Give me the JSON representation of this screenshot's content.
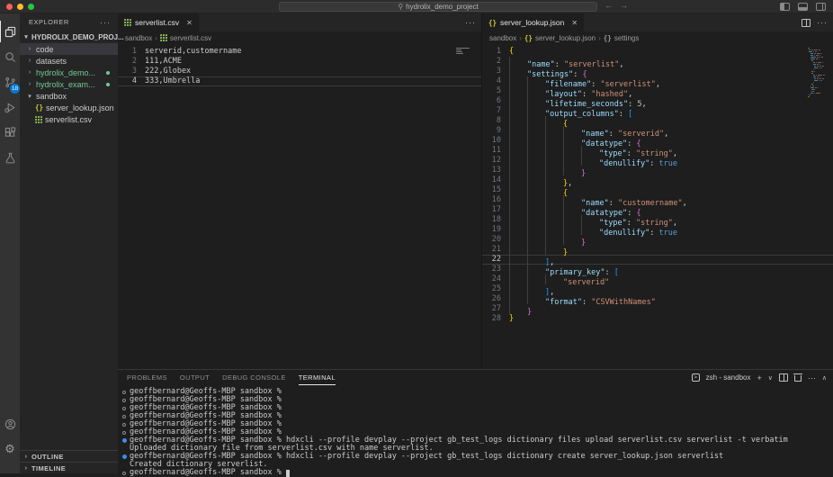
{
  "titlebar": {
    "search_text": "hydrolix_demo_project",
    "back_arrow": "←",
    "forward_arrow": "→",
    "traffic_colors": {
      "close": "#ff5f57",
      "minimize": "#febc2e",
      "zoom": "#28c840"
    }
  },
  "activity_bar": {
    "items": [
      "explorer",
      "search",
      "source-control",
      "run-and-debug",
      "extensions",
      "testing"
    ],
    "active_item": "explorer",
    "source_control_badge": "18",
    "bottom_items": [
      "accounts",
      "settings"
    ]
  },
  "sidebar": {
    "title": "EXPLORER",
    "more_actions": "···",
    "root_label": "HYDROLIX_DEMO_PROJ...",
    "items": [
      {
        "label": "code",
        "kind": "folder",
        "chevron": "right",
        "selected": true
      },
      {
        "label": "datasets",
        "kind": "folder",
        "chevron": "right"
      },
      {
        "label": "hydrolix_demo...",
        "kind": "folder",
        "chevron": "right",
        "green": true,
        "dot": true
      },
      {
        "label": "hydrolix_exam...",
        "kind": "folder",
        "chevron": "right",
        "green": true,
        "dot": true
      },
      {
        "label": "sandbox",
        "kind": "folder",
        "chevron": "down"
      },
      {
        "label": "server_lookup.json",
        "kind": "file",
        "icon": "json"
      },
      {
        "label": "serverlist.csv",
        "kind": "file",
        "icon": "csv"
      }
    ],
    "bottom_sections": [
      "OUTLINE",
      "TIMELINE"
    ]
  },
  "editor_left": {
    "tab_label": "serverlist.csv",
    "tab_icon": "csv",
    "close_glyph": "✕",
    "more_actions": "···",
    "breadcrumb": [
      {
        "label": "sandbox"
      },
      {
        "label": "serverlist.csv",
        "icon": "csv"
      }
    ],
    "active_line": 4,
    "lines": [
      "serverid,customername",
      "111,ACME",
      "222,Globex",
      "333,Umbrella"
    ]
  },
  "editor_right": {
    "tab_label": "server_lookup.json",
    "tab_icon": "json",
    "close_glyph": "✕",
    "more_actions": "···",
    "breadcrumb": [
      {
        "label": "sandbox"
      },
      {
        "label": "server_lookup.json",
        "icon": "json"
      },
      {
        "label": "settings",
        "icon": "json-gray"
      }
    ],
    "active_line": 22,
    "lines": [
      [
        [
          "g",
          "{"
        ]
      ],
      [
        [
          "p",
          "    "
        ],
        [
          "k",
          "\"name\""
        ],
        [
          "p",
          ": "
        ],
        [
          "s",
          "\"serverlist\""
        ],
        [
          "p",
          ","
        ]
      ],
      [
        [
          "p",
          "    "
        ],
        [
          "k",
          "\"settings\""
        ],
        [
          "p",
          ": "
        ],
        [
          "m",
          "{"
        ]
      ],
      [
        [
          "p",
          "        "
        ],
        [
          "k",
          "\"filename\""
        ],
        [
          "p",
          ": "
        ],
        [
          "s",
          "\"serverlist\""
        ],
        [
          "p",
          ","
        ]
      ],
      [
        [
          "p",
          "        "
        ],
        [
          "k",
          "\"layout\""
        ],
        [
          "p",
          ": "
        ],
        [
          "s",
          "\"hashed\""
        ],
        [
          "p",
          ","
        ]
      ],
      [
        [
          "p",
          "        "
        ],
        [
          "k",
          "\"lifetime_seconds\""
        ],
        [
          "p",
          ": "
        ],
        [
          "n",
          "5"
        ],
        [
          "p",
          ","
        ]
      ],
      [
        [
          "p",
          "        "
        ],
        [
          "k",
          "\"output_columns\""
        ],
        [
          "p",
          ": "
        ],
        [
          "u",
          "["
        ]
      ],
      [
        [
          "p",
          "            "
        ],
        [
          "g",
          "{"
        ]
      ],
      [
        [
          "p",
          "                "
        ],
        [
          "k",
          "\"name\""
        ],
        [
          "p",
          ": "
        ],
        [
          "s",
          "\"serverid\""
        ],
        [
          "p",
          ","
        ]
      ],
      [
        [
          "p",
          "                "
        ],
        [
          "k",
          "\"datatype\""
        ],
        [
          "p",
          ": "
        ],
        [
          "m",
          "{"
        ]
      ],
      [
        [
          "p",
          "                    "
        ],
        [
          "k",
          "\"type\""
        ],
        [
          "p",
          ": "
        ],
        [
          "s",
          "\"string\""
        ],
        [
          "p",
          ","
        ]
      ],
      [
        [
          "p",
          "                    "
        ],
        [
          "k",
          "\"denullify\""
        ],
        [
          "p",
          ": "
        ],
        [
          "b",
          "true"
        ]
      ],
      [
        [
          "p",
          "                "
        ],
        [
          "m",
          "}"
        ]
      ],
      [
        [
          "p",
          "            "
        ],
        [
          "g",
          "}"
        ],
        [
          "p",
          ","
        ]
      ],
      [
        [
          "p",
          "            "
        ],
        [
          "g",
          "{"
        ]
      ],
      [
        [
          "p",
          "                "
        ],
        [
          "k",
          "\"name\""
        ],
        [
          "p",
          ": "
        ],
        [
          "s",
          "\"customername\""
        ],
        [
          "p",
          ","
        ]
      ],
      [
        [
          "p",
          "                "
        ],
        [
          "k",
          "\"datatype\""
        ],
        [
          "p",
          ": "
        ],
        [
          "m",
          "{"
        ]
      ],
      [
        [
          "p",
          "                    "
        ],
        [
          "k",
          "\"type\""
        ],
        [
          "p",
          ": "
        ],
        [
          "s",
          "\"string\""
        ],
        [
          "p",
          ","
        ]
      ],
      [
        [
          "p",
          "                    "
        ],
        [
          "k",
          "\"denullify\""
        ],
        [
          "p",
          ": "
        ],
        [
          "b",
          "true"
        ]
      ],
      [
        [
          "p",
          "                "
        ],
        [
          "m",
          "}"
        ]
      ],
      [
        [
          "p",
          "            "
        ],
        [
          "g",
          "}"
        ]
      ],
      [
        [
          "p",
          "        "
        ],
        [
          "u",
          "]"
        ],
        [
          "p",
          ","
        ]
      ],
      [
        [
          "p",
          "        "
        ],
        [
          "k",
          "\"primary_key\""
        ],
        [
          "p",
          ": "
        ],
        [
          "u",
          "["
        ]
      ],
      [
        [
          "p",
          "            "
        ],
        [
          "s",
          "\"serverid\""
        ]
      ],
      [
        [
          "p",
          "        "
        ],
        [
          "u",
          "]"
        ],
        [
          "p",
          ","
        ]
      ],
      [
        [
          "p",
          "        "
        ],
        [
          "k",
          "\"format\""
        ],
        [
          "p",
          ": "
        ],
        [
          "s",
          "\"CSVWithNames\""
        ]
      ],
      [
        [
          "p",
          "    "
        ],
        [
          "m",
          "}"
        ]
      ],
      [
        [
          "g",
          "}"
        ]
      ]
    ]
  },
  "panel": {
    "tabs": [
      "PROBLEMS",
      "OUTPUT",
      "DEBUG CONSOLE",
      "TERMINAL"
    ],
    "active_tab": "TERMINAL",
    "shell_label": "zsh - sandbox",
    "actions": {
      "new": "+",
      "dropdown": "∨",
      "more": "···",
      "maximize": "∧"
    },
    "terminal_lines": [
      {
        "marker": "empty",
        "text": "geoffbernard@Geoffs-MBP sandbox %"
      },
      {
        "marker": "empty",
        "text": "geoffbernard@Geoffs-MBP sandbox %"
      },
      {
        "marker": "empty",
        "text": "geoffbernard@Geoffs-MBP sandbox %"
      },
      {
        "marker": "empty",
        "text": "geoffbernard@Geoffs-MBP sandbox %"
      },
      {
        "marker": "empty",
        "text": "geoffbernard@Geoffs-MBP sandbox %"
      },
      {
        "marker": "empty",
        "text": "geoffbernard@Geoffs-MBP sandbox %"
      },
      {
        "marker": "blue",
        "text": "geoffbernard@Geoffs-MBP sandbox % hdxcli --profile devplay --project gb_test_logs dictionary files upload serverlist.csv serverlist -t verbatim"
      },
      {
        "marker": "none",
        "text": "Uploaded dictionary file from serverlist.csv with name serverlist."
      },
      {
        "marker": "blue",
        "text": "geoffbernard@Geoffs-MBP sandbox % hdxcli --profile devplay --project gb_test_logs dictionary create server_lookup.json serverlist"
      },
      {
        "marker": "none",
        "text": "Created dictionary serverlist."
      },
      {
        "marker": "empty",
        "text": "geoffbernard@Geoffs-MBP sandbox % ",
        "cursor": true
      }
    ]
  }
}
